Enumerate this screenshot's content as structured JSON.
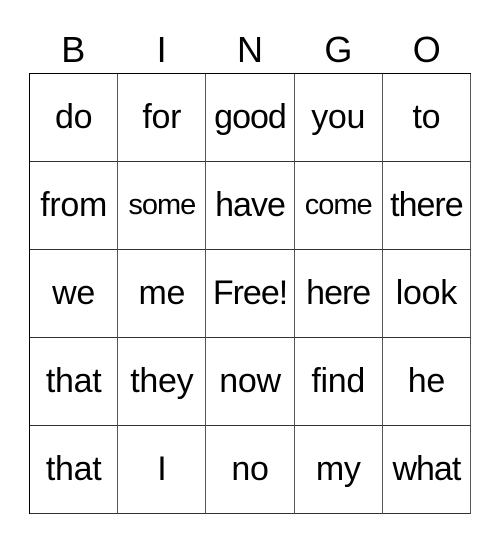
{
  "header": [
    "B",
    "I",
    "N",
    "G",
    "O"
  ],
  "rows": [
    [
      "do",
      "for",
      "good",
      "you",
      "to"
    ],
    [
      "from",
      "some",
      "have",
      "come",
      "there"
    ],
    [
      "we",
      "me",
      "Free!",
      "here",
      "look"
    ],
    [
      "that",
      "they",
      "now",
      "find",
      "he"
    ],
    [
      "that",
      "I",
      "no",
      "my",
      "what"
    ]
  ]
}
